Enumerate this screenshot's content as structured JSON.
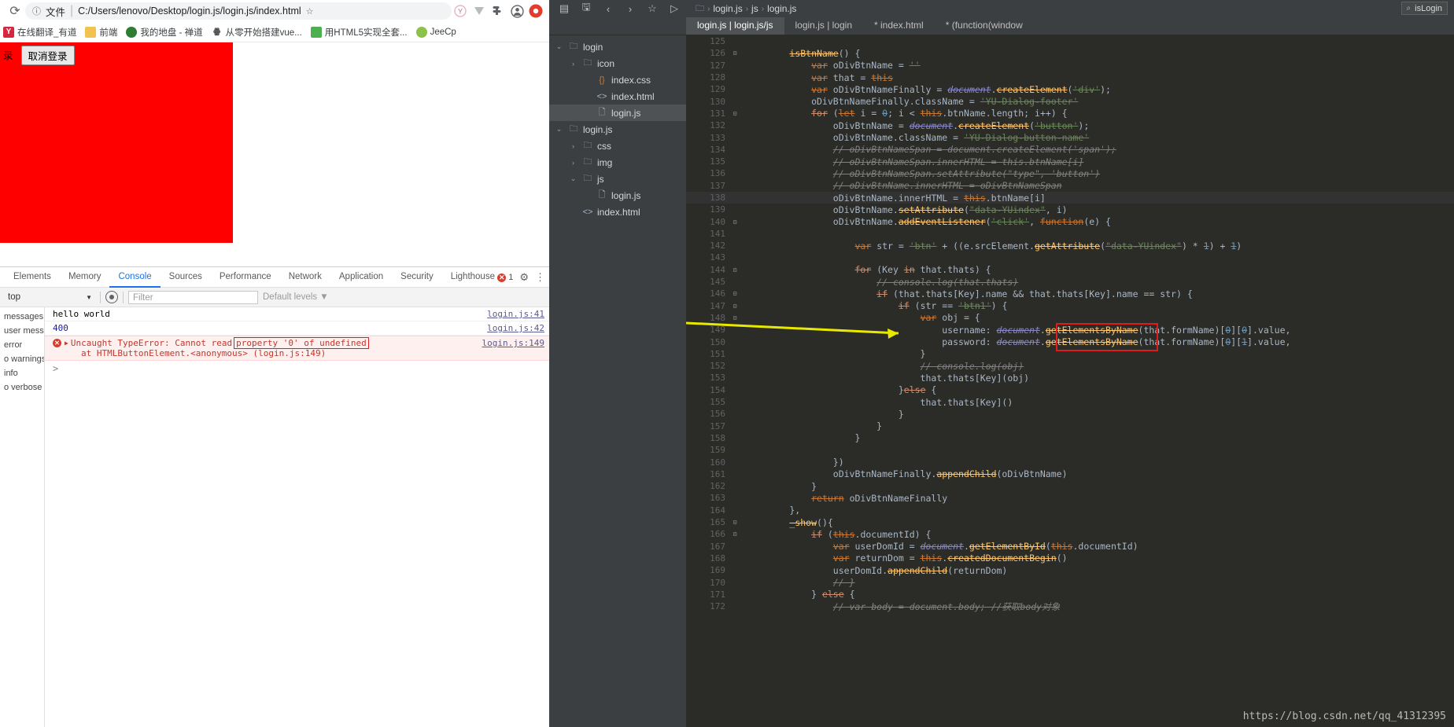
{
  "browser": {
    "omnibox": {
      "reload_icon": "reload-icon",
      "info_icon": "info-icon",
      "file_label": "文件",
      "separator": "|",
      "url": "C:/Users/lenovo/Desktop/login.js/login.js/index.html",
      "star_icon": "star-icon",
      "profile_icon": "profile-icon",
      "extension_icons": [
        "extension-v-icon",
        "extension-puzzle-icon",
        "extension-y-icon"
      ]
    },
    "bookmarks": [
      {
        "label": "在线翻译_有道",
        "icon_color": "#d7263d",
        "icon_glyph": "Y"
      },
      {
        "label": "前端",
        "icon_color": "#f2c14e",
        "icon_glyph": ""
      },
      {
        "label": "我的地盘 - 禅道",
        "icon_color": "#2e7d32",
        "icon_glyph": ""
      },
      {
        "label": "从零开始搭建vue...",
        "icon_color": "#3a3a3a",
        "icon_glyph": ""
      },
      {
        "label": "用HTML5实现全套...",
        "icon_color": "#4caf50",
        "icon_glyph": ""
      },
      {
        "label": "JeeCp",
        "icon_color": "#8bc34a",
        "icon_glyph": ""
      }
    ],
    "page": {
      "buttons": [
        "录",
        "取消登录"
      ],
      "red_block_color": "#ff0000"
    },
    "devtools": {
      "tabs": [
        "Elements",
        "Memory",
        "Console",
        "Sources",
        "Performance",
        "Network",
        "Application",
        "Security",
        "Lighthouse"
      ],
      "active_tab": "Console",
      "error_count": "1",
      "settings_icon": "gear-icon",
      "more_icon": "kebab-menu-icon",
      "toolbar": {
        "context": "top",
        "eye_icon": "eye-icon",
        "filter_placeholder": "Filter",
        "levels": "Default levels"
      },
      "sidebar_levels": [
        "messages",
        "user mess...",
        "error",
        "o warnings",
        "info",
        "o verbose"
      ],
      "messages": [
        {
          "type": "log",
          "text": "hello world",
          "link": "login.js:41"
        },
        {
          "type": "number",
          "text": "400",
          "link": "login.js:42"
        },
        {
          "type": "error",
          "prefix": "Uncaught TypeError: Cannot read",
          "highlight": "property '0' of undefined",
          "line2": "at HTMLButtonElement.<anonymous> (login.js:149)",
          "link": "login.js:149"
        }
      ],
      "prompt": ">"
    }
  },
  "editor": {
    "toolbar_icons": [
      "project-structure-icon",
      "save-icon",
      "back-icon",
      "forward-icon",
      "bookmark-icon",
      "run-icon"
    ],
    "breadcrumb": [
      "login.js",
      "js",
      "login.js"
    ],
    "breadcrumb_root_icon": "folder-icon",
    "search": {
      "icon": "search-icon",
      "text": "isLogin"
    },
    "tabs": [
      {
        "label": "login.js | login.js/js",
        "active": true
      },
      {
        "label": "login.js | login",
        "active": false
      },
      {
        "label": "* index.html",
        "active": false
      },
      {
        "label": "* (function(window",
        "active": false
      }
    ],
    "file_tree": [
      {
        "depth": 0,
        "arrow": "down",
        "icon": "folder",
        "label": "login",
        "selected": false
      },
      {
        "depth": 1,
        "arrow": "right",
        "icon": "folder",
        "label": "icon",
        "selected": false
      },
      {
        "depth": 2,
        "arrow": "none",
        "icon": "css",
        "label": "index.css",
        "selected": false
      },
      {
        "depth": 2,
        "arrow": "none",
        "icon": "html",
        "label": "index.html",
        "selected": false
      },
      {
        "depth": 2,
        "arrow": "none",
        "icon": "js",
        "label": "login.js",
        "selected": true
      },
      {
        "depth": 0,
        "arrow": "down",
        "icon": "folder",
        "label": "login.js",
        "selected": false
      },
      {
        "depth": 1,
        "arrow": "right",
        "icon": "folder",
        "label": "css",
        "selected": false
      },
      {
        "depth": 1,
        "arrow": "right",
        "icon": "folder",
        "label": "img",
        "selected": false
      },
      {
        "depth": 1,
        "arrow": "down",
        "icon": "folder",
        "label": "js",
        "selected": false
      },
      {
        "depth": 2,
        "arrow": "none",
        "icon": "js",
        "label": "login.js",
        "selected": false
      },
      {
        "depth": 1,
        "arrow": "none",
        "icon": "html",
        "label": "index.html",
        "selected": false
      }
    ],
    "code": {
      "first_line": 125,
      "current_line": 138,
      "lines": [
        {
          "n": 125,
          "fold": "",
          "t": ""
        },
        {
          "n": 126,
          "fold": "-",
          "t": "        <s class='fn'>isBtnName</s>() {"
        },
        {
          "n": 127,
          "fold": "",
          "t": "            <s class='kw'>var</s> oDivBtnName = <s class='str'>''</s>"
        },
        {
          "n": 128,
          "fold": "",
          "t": "            <s class='kw'>var</s> that = <s class='kw'>this</s>"
        },
        {
          "n": 129,
          "fold": "",
          "t": "            <s class='kw'>var</s> oDivBtnNameFinally = <s class='ita'>document</s>.<s class='meth'>createElement</s>(<s class='str'>'div'</s>);"
        },
        {
          "n": 130,
          "fold": "",
          "t": "            oDivBtnNameFinally.className = <s class='str'>'YU-Dialog-footer'</s>"
        },
        {
          "n": 131,
          "fold": "-",
          "t": "            <s class='kw2'>for</s> (<s class='kw'>let</s> i = <s class='num2'>0</s>; i &lt; <s class='kw'>this</s>.btnName.length; i++) {"
        },
        {
          "n": 132,
          "fold": "",
          "t": "                oDivBtnName = <s class='ita'>document</s>.<s class='meth'>createElement</s>(<s class='str'>'button'</s>);"
        },
        {
          "n": 133,
          "fold": "",
          "t": "                oDivBtnName.className = <s class='str'>'YU-Dialog-button-name'</s>"
        },
        {
          "n": 134,
          "fold": "",
          "t": "                <s class='cmt'>// oDivBtnNameSpan = document.createElement('span');</s>"
        },
        {
          "n": 135,
          "fold": "",
          "t": "                <s class='cmt'>// oDivBtnNameSpan.innerHTML = this.btnName[i]</s>"
        },
        {
          "n": 136,
          "fold": "",
          "t": "                <s class='cmt'>// oDivBtnNameSpan.setAttribute(\"type\", 'button')</s>"
        },
        {
          "n": 137,
          "fold": "",
          "t": "                <s class='cmt'>// oDivBtnName.innerHTML = oDivBtnNameSpan</s>"
        },
        {
          "n": 138,
          "fold": "",
          "t": "                oDivBtnName.innerHTML = <s class='kw'>this</s>.btnName[i]"
        },
        {
          "n": 139,
          "fold": "",
          "t": "                oDivBtnName.<s class='meth'>setAttribute</s>(<s class='str'>\"data-YUindex\"</s>, i)"
        },
        {
          "n": 140,
          "fold": "-",
          "t": "                oDivBtnName.<s class='meth'>addEventListener</s>(<s class='str'>'click'</s>, <s class='kw'>function</s>(e) {"
        },
        {
          "n": 141,
          "fold": "",
          "t": ""
        },
        {
          "n": 142,
          "fold": "",
          "t": "                    <s class='kw'>var</s> str = <s class='str'>'btn'</s> + ((e.srcElement.<s class='meth'>getAttribute</s>(<s class='str'>\"data-YUindex\"</s>) * <s class='num2'>1</s>) + <s class='num2'>1</s>)"
        },
        {
          "n": 143,
          "fold": "",
          "t": ""
        },
        {
          "n": 144,
          "fold": "-",
          "t": "                    <s class='kw2'>for</s> (Key <s class='kw2'>in</s> that.thats) {"
        },
        {
          "n": 145,
          "fold": "",
          "t": "                        <s class='cmt'>// console.log(that.thats)</s>"
        },
        {
          "n": 146,
          "fold": "-",
          "t": "                        <s class='kw2'>if</s> (that.thats[Key].name &amp;&amp; that.thats[Key].name == str) {"
        },
        {
          "n": 147,
          "fold": "-",
          "t": "                            <s class='kw2'>if</s> (str == <s class='str'>'btn1'</s>) {"
        },
        {
          "n": 148,
          "fold": "-",
          "t": "                                <s class='kw'>var</s> obj = {"
        },
        {
          "n": 149,
          "fold": "",
          "t": "                                    username: <s class='ita'>document</s>.<s class='meth'>getElementsByName</s>(that.formName)[<s class='num2'>0</s>][<s class='num2'>0</s>].value,"
        },
        {
          "n": 150,
          "fold": "",
          "t": "                                    password: <s class='ita'>document</s>.<s class='meth'>getElementsByName</s>(that.formName)[<s class='num2'>0</s>][<s class='num2'>1</s>].value,"
        },
        {
          "n": 151,
          "fold": "",
          "t": "                                }"
        },
        {
          "n": 152,
          "fold": "",
          "t": "                                <s class='cmt'>// console.log(obj)</s>"
        },
        {
          "n": 153,
          "fold": "",
          "t": "                                that.thats[Key](obj)"
        },
        {
          "n": 154,
          "fold": "",
          "t": "                            }<s class='kw2'>else</s> {"
        },
        {
          "n": 155,
          "fold": "",
          "t": "                                that.thats[Key]()"
        },
        {
          "n": 156,
          "fold": "",
          "t": "                            }"
        },
        {
          "n": 157,
          "fold": "",
          "t": "                        }"
        },
        {
          "n": 158,
          "fold": "",
          "t": "                    }"
        },
        {
          "n": 159,
          "fold": "",
          "t": ""
        },
        {
          "n": 160,
          "fold": "",
          "t": "                })"
        },
        {
          "n": 161,
          "fold": "",
          "t": "                oDivBtnNameFinally.<s class='meth'>appendChild</s>(oDivBtnName)"
        },
        {
          "n": 162,
          "fold": "",
          "t": "            }"
        },
        {
          "n": 163,
          "fold": "",
          "t": "            <s class='kw'>return</s> oDivBtnNameFinally"
        },
        {
          "n": 164,
          "fold": "",
          "t": "        },"
        },
        {
          "n": 165,
          "fold": "-",
          "t": "        <s class='fn'>_show</s>(){"
        },
        {
          "n": 166,
          "fold": "-",
          "t": "            <s class='kw2'>if</s> (<s class='kw'>this</s>.documentId) {"
        },
        {
          "n": 167,
          "fold": "",
          "t": "                <s class='kw'>var</s> userDomId = <s class='ita'>document</s>.<s class='meth'>getElementById</s>(<s class='kw'>this</s>.documentId)"
        },
        {
          "n": 168,
          "fold": "",
          "t": "                <s class='kw'>var</s> returnDom = <s class='kw'>this</s>.<s class='meth'>createdDocumentBegin</s>()"
        },
        {
          "n": 169,
          "fold": "",
          "t": "                userDomId.<s class='meth'>appendChild</s>(returnDom)"
        },
        {
          "n": 170,
          "fold": "",
          "t": "                <s class='cmt'>// }</s>"
        },
        {
          "n": 171,
          "fold": "",
          "t": "            } <s class='kw2'>else</s> {"
        },
        {
          "n": 172,
          "fold": "",
          "t": "                <s class='cmt'>// var body = document.body; //获取body对象</s>"
        }
      ]
    },
    "annotations": {
      "red_box_color": "#e01b1b",
      "arrow_color": "#e8e800"
    },
    "watermark": "https://blog.csdn.net/qq_41312395"
  }
}
